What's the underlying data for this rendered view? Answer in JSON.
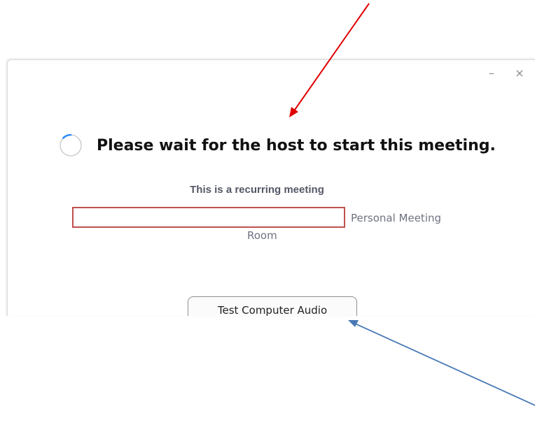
{
  "window": {
    "minimize_glyph": "–",
    "close_glyph": "×"
  },
  "main": {
    "title": "Please wait for the host to start this meeting.",
    "recurring_label": "This is a recurring meeting",
    "meeting_id_value": "",
    "pmr_label_line1": "Personal Meeting",
    "pmr_label_line2": "Room",
    "test_audio_button": "Test Computer Audio"
  },
  "icons": {
    "spinner": "loading-spinner-icon"
  },
  "annotations": {
    "red_arrow_color": "#e00000",
    "blue_arrow_color": "#4a7ab5",
    "highlight_box_color": "#c0504d"
  }
}
